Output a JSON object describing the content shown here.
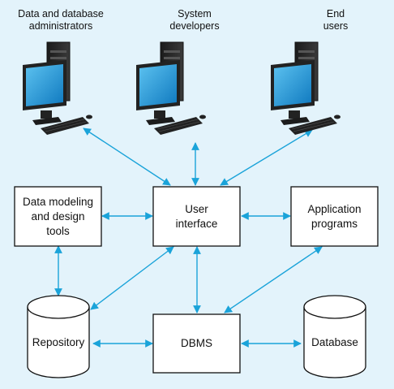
{
  "users": [
    {
      "label_line1": "Data and database",
      "label_line2": "administrators"
    },
    {
      "label_line1": "System",
      "label_line2": "developers"
    },
    {
      "label_line1": "End",
      "label_line2": "users"
    }
  ],
  "boxes": {
    "data_modeling_line1": "Data modeling",
    "data_modeling_line2": "and design",
    "data_modeling_line3": "tools",
    "user_interface_line1": "User",
    "user_interface_line2": "interface",
    "application_programs_line1": "Application",
    "application_programs_line2": "programs",
    "dbms": "DBMS"
  },
  "cylinders": {
    "repository": "Repository",
    "database": "Database"
  },
  "colors": {
    "background": "#e3f3fb",
    "arrow": "#1aa3d9",
    "screen": "#1a8fd1",
    "box_fill": "#ffffff",
    "box_stroke": "#111111"
  },
  "icons": {
    "workstation": "computer-workstation-icon",
    "storage": "cylinder-storage-icon"
  }
}
